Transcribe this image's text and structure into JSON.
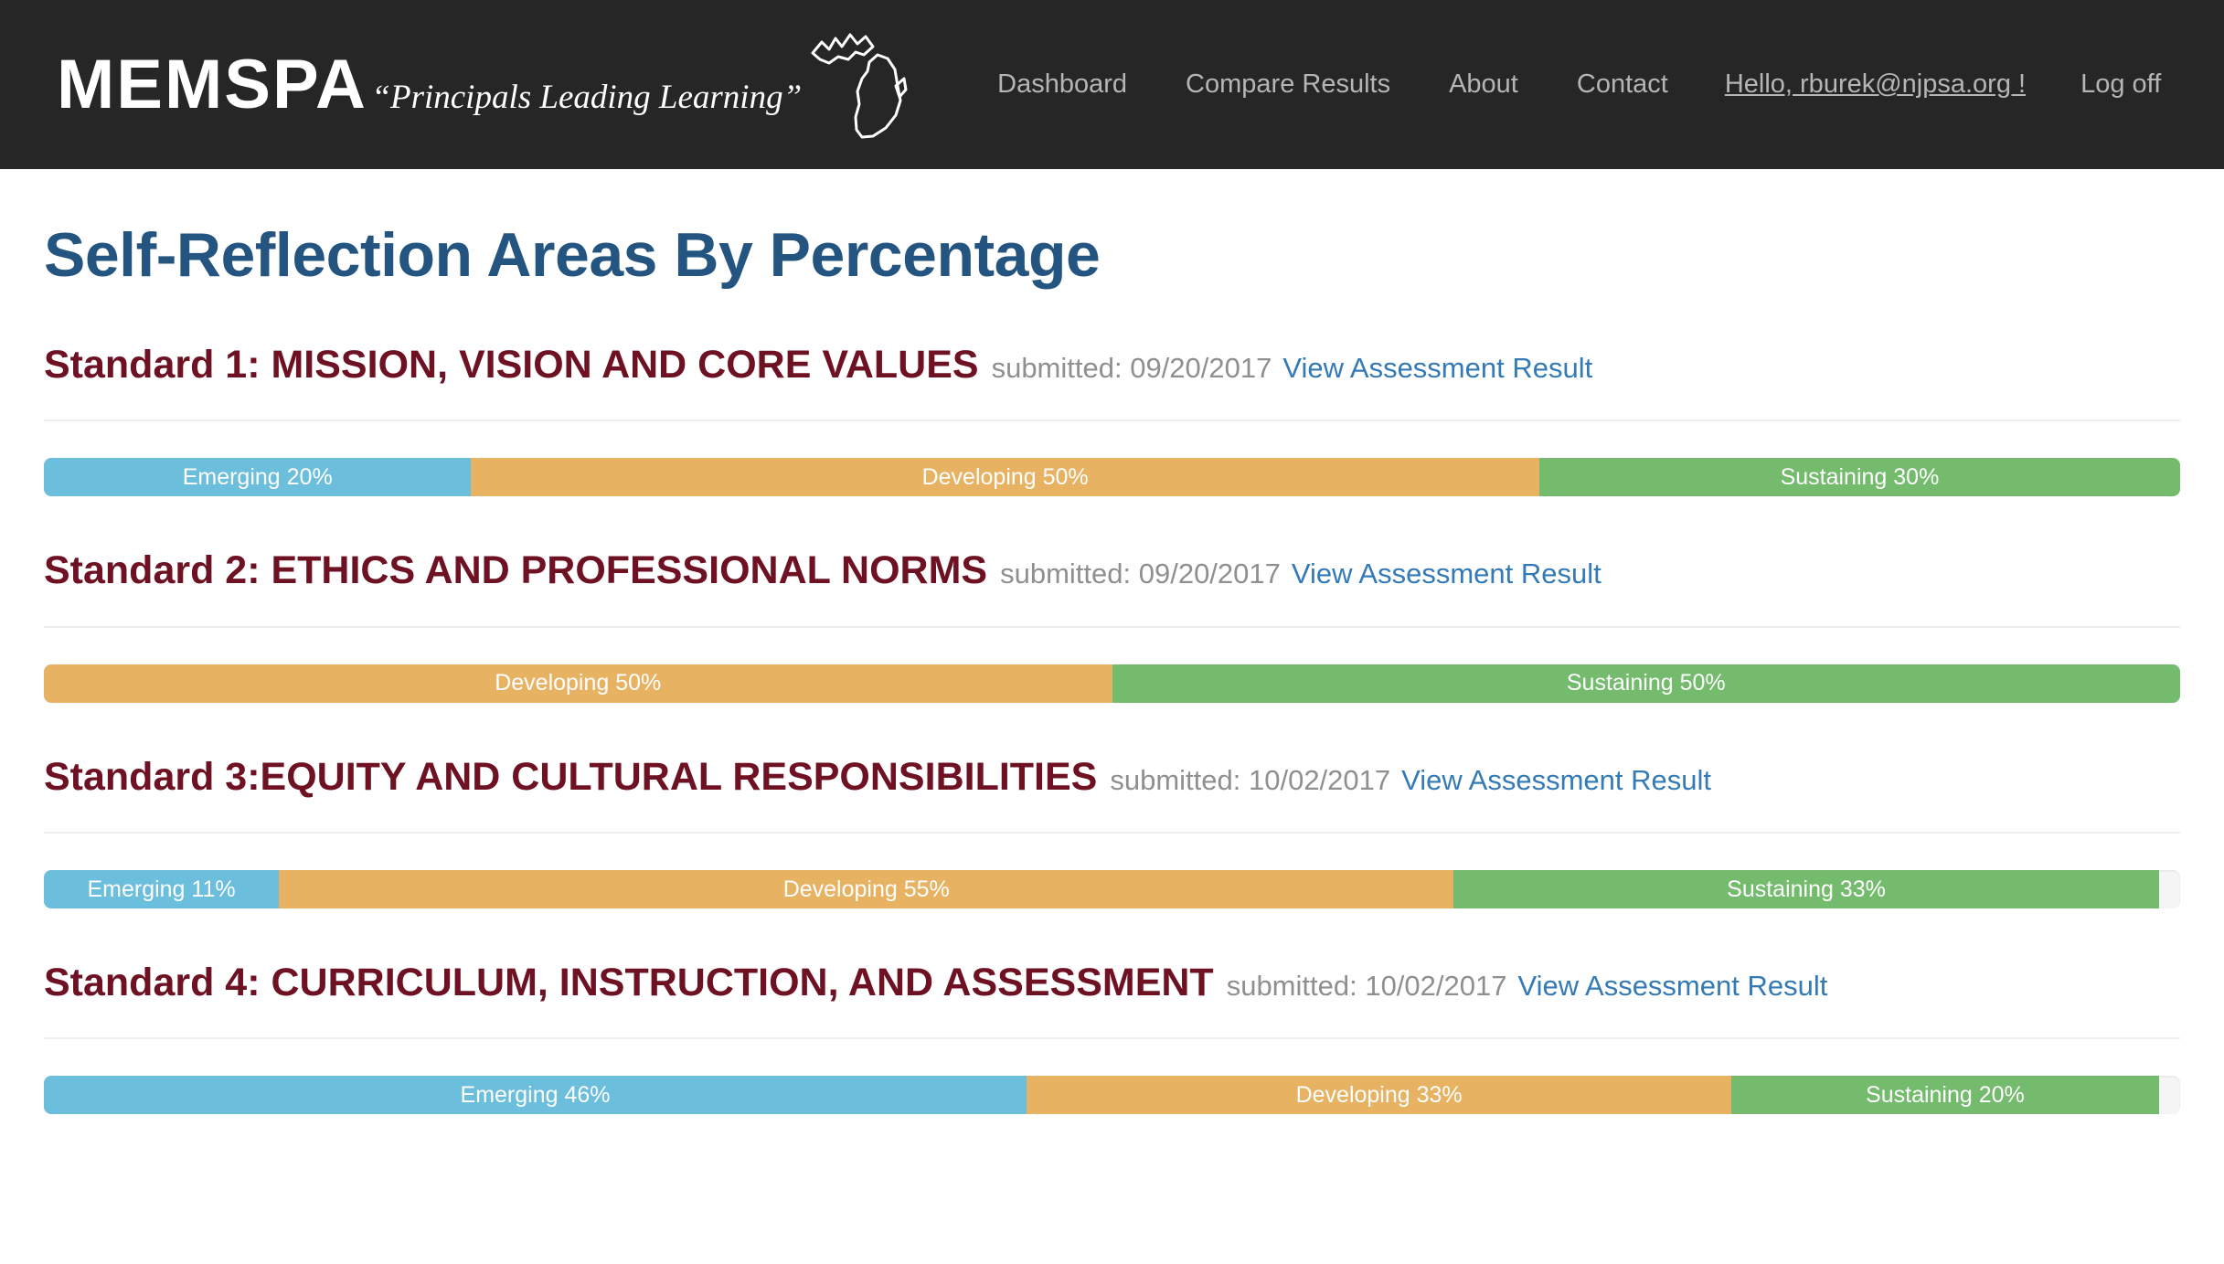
{
  "navbar": {
    "brand": {
      "word": "MEMSPA",
      "tagline": "“Principals Leading Learning”",
      "map_icon": "michigan-state-outline-icon"
    },
    "links": [
      {
        "label": "Dashboard"
      },
      {
        "label": "Compare Results"
      },
      {
        "label": "About"
      },
      {
        "label": "Contact"
      }
    ],
    "greeting": "Hello, rburek@njpsa.org !",
    "logoff_label": "Log off",
    "background_color": "#262626",
    "link_color": "#b5b5b5"
  },
  "page": {
    "title": "Self-Reflection Areas By Percentage",
    "title_color": "#245580",
    "submitted_prefix": "submitted:",
    "view_link_label": "View Assessment Result"
  },
  "legend_colors": {
    "emerging": "#6cbedd",
    "developing": "#e8b263",
    "sustaining": "#74bb6e",
    "track": "#f5f5f5",
    "heading": "#6d1123",
    "link": "#337ab7",
    "muted": "#8f8f8f"
  },
  "chart_data": {
    "type": "bar",
    "title": "Self-Reflection Areas By Percentage",
    "orientation": "horizontal-stacked",
    "xlabel": "",
    "ylabel": "",
    "xlim": [
      0,
      100
    ],
    "grid": false,
    "legend": [
      "Emerging",
      "Developing",
      "Sustaining"
    ],
    "legend_position": "inline-labels",
    "categories": [
      "Standard 1: MISSION, VISION AND CORE VALUES",
      "Standard 2: ETHICS AND PROFESSIONAL NORMS",
      "Standard 3:EQUITY AND CULTURAL RESPONSIBILITIES",
      "Standard 4: CURRICULUM, INSTRUCTION, AND ASSESSMENT"
    ],
    "series": [
      {
        "name": "Emerging",
        "values": [
          20,
          0,
          11,
          46
        ]
      },
      {
        "name": "Developing",
        "values": [
          50,
          50,
          55,
          33
        ]
      },
      {
        "name": "Sustaining",
        "values": [
          30,
          50,
          33,
          20
        ]
      }
    ]
  },
  "standards": [
    {
      "title": "Standard 1: MISSION, VISION AND CORE VALUES",
      "submitted": "submitted: 09/20/2017",
      "link_label": "View Assessment Result",
      "segments": [
        {
          "label": "Emerging 20%",
          "percent": 20,
          "key": "emerging"
        },
        {
          "label": "Developing 50%",
          "percent": 50,
          "key": "developing"
        },
        {
          "label": "Sustaining 30%",
          "percent": 30,
          "key": "sustaining"
        }
      ]
    },
    {
      "title": "Standard 2: ETHICS AND PROFESSIONAL NORMS",
      "submitted": "submitted: 09/20/2017",
      "link_label": "View Assessment Result",
      "segments": [
        {
          "label": "Developing 50%",
          "percent": 50,
          "key": "developing"
        },
        {
          "label": "Sustaining 50%",
          "percent": 50,
          "key": "sustaining"
        }
      ]
    },
    {
      "title": "Standard 3:EQUITY AND CULTURAL RESPONSIBILITIES",
      "submitted": "submitted: 10/02/2017",
      "link_label": "View Assessment Result",
      "segments": [
        {
          "label": "Emerging 11%",
          "percent": 11,
          "key": "emerging"
        },
        {
          "label": "Developing 55%",
          "percent": 55,
          "key": "developing"
        },
        {
          "label": "Sustaining 33%",
          "percent": 33,
          "key": "sustaining"
        }
      ]
    },
    {
      "title": "Standard 4: CURRICULUM, INSTRUCTION, AND ASSESSMENT",
      "submitted": "submitted: 10/02/2017",
      "link_label": "View Assessment Result",
      "segments": [
        {
          "label": "Emerging 46%",
          "percent": 46,
          "key": "emerging"
        },
        {
          "label": "Developing 33%",
          "percent": 33,
          "key": "developing"
        },
        {
          "label": "Sustaining 20%",
          "percent": 20,
          "key": "sustaining"
        }
      ]
    }
  ]
}
